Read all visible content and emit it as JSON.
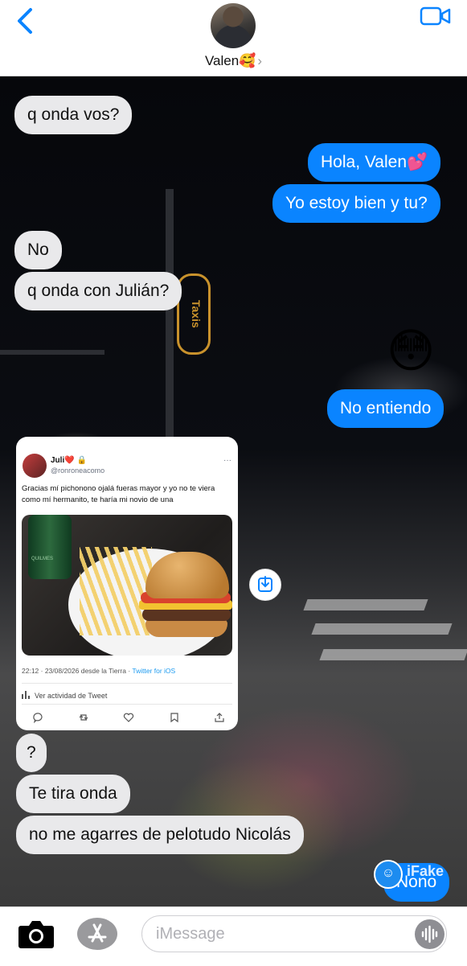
{
  "header": {
    "contact_name": "Valen🥰",
    "chevron": "›",
    "back_icon": "chevron-left-icon",
    "video_icon": "video-camera-icon"
  },
  "messages": [
    {
      "side": "in",
      "text": "q onda vos?"
    },
    {
      "side": "out",
      "text": "Hola, Valen💕"
    },
    {
      "side": "out",
      "text": "Yo estoy bien y tu?"
    },
    {
      "side": "in",
      "text": "No"
    },
    {
      "side": "in",
      "text": "q onda con Julián?"
    },
    {
      "side": "out",
      "text": "😳"
    },
    {
      "side": "out",
      "text": "No entiendo"
    },
    {
      "side": "in",
      "text": "?"
    },
    {
      "side": "in",
      "text": "Te tira onda"
    },
    {
      "side": "in",
      "text": "no me agarres de pelotudo Nicolás"
    },
    {
      "side": "out",
      "text": "Nono"
    }
  ],
  "tweet": {
    "name": "Juli❤️ 🔒",
    "handle": "@ronroneacomo",
    "more": "···",
    "text": "Gracias mí pichonono ojalá fueras mayor y yo no te viera como mí hermanito, te haría mi novio de una",
    "time": "22:12 · 23/08/2026 desde la Tierra · ",
    "source": "Twitter for iOS",
    "activity": "Ver actividad de Tweet",
    "bottle_label": "QUILMES"
  },
  "watermark": {
    "label": "iFake"
  },
  "composer": {
    "placeholder": "iMessage"
  },
  "colors": {
    "outgoing": "#0a84ff",
    "incoming": "#e9e9eb",
    "accent": "#0a84ff"
  }
}
